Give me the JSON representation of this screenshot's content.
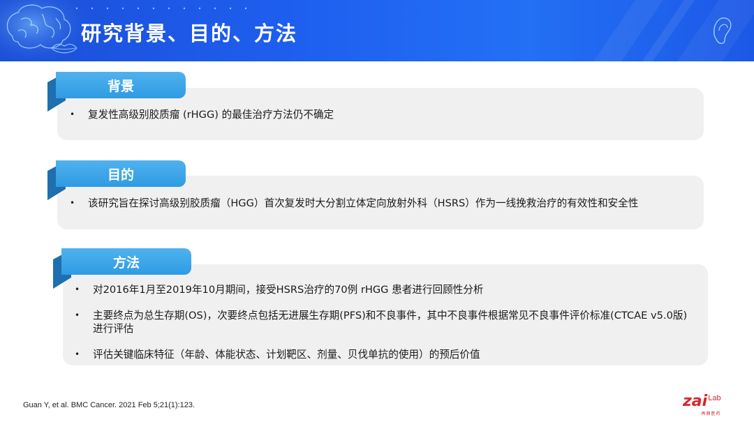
{
  "header": {
    "title": "研究背景、目的、方法"
  },
  "sections": [
    {
      "label": "背景",
      "bullets": [
        "复发性高级别胶质瘤 (rHGG) 的最佳治疗方法仍不确定"
      ]
    },
    {
      "label": "目的",
      "bullets": [
        "该研究旨在探讨高级别胶质瘤（HGG）首次复发时大分割立体定向放射外科（HSRS）作为一线挽救治疗的有效性和安全性"
      ]
    },
    {
      "label": "方法",
      "bullets": [
        "对2016年1月至2019年10月期间，接受HSRS治疗的70例 rHGG 患者进行回顾性分析",
        "主要终点为总生存期(OS)，次要终点包括无进展生存期(PFS)和不良事件，其中不良事件根据常见不良事件评价标准(CTCAE v5.0版)进行评估",
        "评估关键临床特征（年龄、体能状态、计划靶区、剂量、贝伐单抗的使用）的预后价值"
      ]
    }
  ],
  "footer": {
    "citation": "Guan Y, et al. BMC Cancer. 2021 Feb 5;21(1):123.",
    "logo_main": "zai",
    "logo_sub": "Lab",
    "logo_cn": "再鼎医药"
  },
  "colors": {
    "banner": "#1e5ff0",
    "tab": "#3aa4e8",
    "tab_fold": "#1f6fae",
    "card": "#f0f0f0",
    "logo_red": "#d7262c"
  },
  "icons": [
    "brain-icon",
    "lips-icon",
    "ear-icon",
    "bullet-dot"
  ]
}
